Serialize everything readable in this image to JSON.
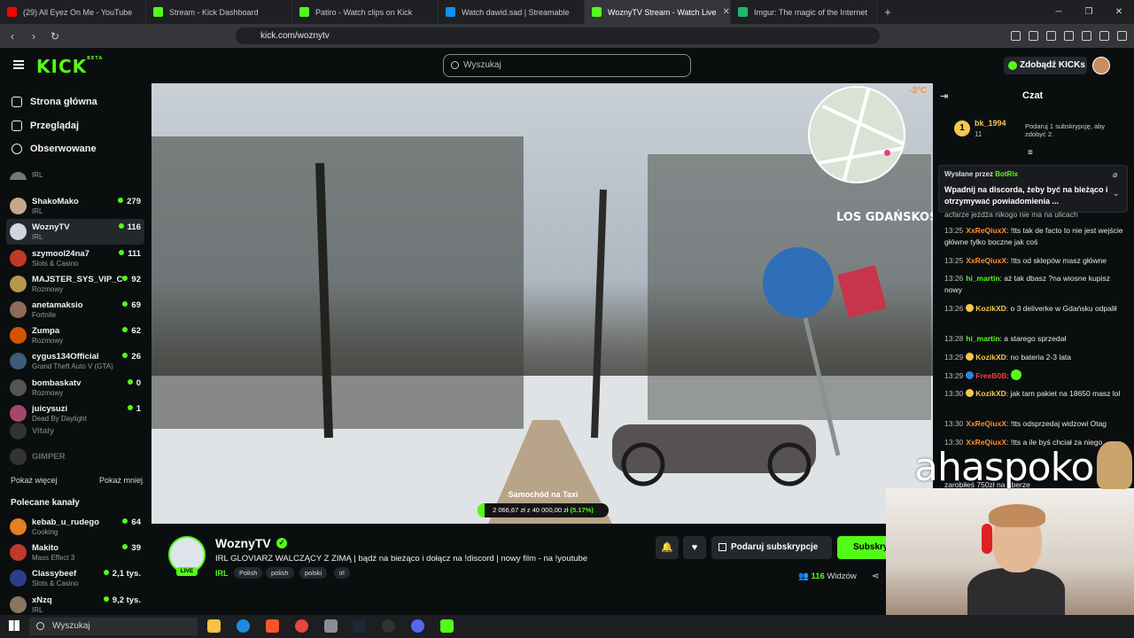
{
  "browser": {
    "tabs": [
      {
        "title": "(29) All Eyez On Me - YouTube",
        "color": "#ff0000"
      },
      {
        "title": "Stream - Kick Dashboard",
        "color": "#53fc18"
      },
      {
        "title": "Patiro - Watch clips on Kick",
        "color": "#53fc18"
      },
      {
        "title": "Watch dawid.sad | Streamable",
        "color": "#0f90fa"
      },
      {
        "title": "WoznyTV Stream - Watch Live",
        "color": "#53fc18"
      },
      {
        "title": "Imgur: The magic of the Internet",
        "color": "#1bb76e"
      }
    ],
    "url": "kick.com/woznytv"
  },
  "header": {
    "logo": "KICK",
    "logo_sup": "BETA",
    "search_placeholder": "Wyszukaj",
    "get_kicks": "Zdobądź KICKs"
  },
  "sidebar": {
    "nav": [
      "Strona główna",
      "Przeglądaj",
      "Obserwowane"
    ],
    "followed": [
      {
        "name": "",
        "category": "IRL",
        "viewers": "",
        "color": "#777"
      },
      {
        "name": "ShakoMako",
        "category": "IRL",
        "viewers": "279",
        "color": "#c6a78a"
      },
      {
        "name": "WoznyTV",
        "category": "IRL",
        "viewers": "116",
        "color": "#cfd6de"
      },
      {
        "name": "szymool24na7",
        "category": "Slots & Casino",
        "viewers": "111",
        "color": "#c0392b"
      },
      {
        "name": "MAJSTER_SYS_VIP_C",
        "category": "Rozmowy",
        "viewers": "92",
        "color": "#b7964d"
      },
      {
        "name": "anetamaksio",
        "category": "Fortnite",
        "viewers": "69",
        "color": "#8e6b5a"
      },
      {
        "name": "Zumpa",
        "category": "Rozmowy",
        "viewers": "62",
        "color": "#d35400"
      },
      {
        "name": "cygus134Official",
        "category": "Grand Theft Auto V (GTA)",
        "viewers": "26",
        "color": "#3b5d7a"
      },
      {
        "name": "bombaskatv",
        "category": "Rozmowy",
        "viewers": "0",
        "color": "#555"
      },
      {
        "name": "juicysuzi",
        "category": "Dead By Daylight",
        "viewers": "1",
        "color": "#a3476b"
      }
    ],
    "offline": [
      "Vitaly",
      "GIMPER"
    ],
    "show_more": "Pokaż więcej",
    "show_less": "Pokaż mniej",
    "recommended_title": "Polecane kanały",
    "recommended": [
      {
        "name": "kebab_u_rudego",
        "category": "Cooking",
        "viewers": "64",
        "color": "#e67e22"
      },
      {
        "name": "Makito",
        "category": "Mass Effect 3",
        "viewers": "39",
        "color": "#c0392b"
      },
      {
        "name": "Classybeef",
        "category": "Slots & Casino",
        "viewers": "2,1 tys.",
        "color": "#2c3e8a"
      },
      {
        "name": "xNzq",
        "category": "IRL",
        "viewers": "9,2 tys.",
        "color": "#8a7560"
      }
    ]
  },
  "video": {
    "temperature": "-3°C",
    "map_label": "LOS GDAŃSKOS",
    "goal_title": "Samochód na Taxi",
    "goal_current": "2 066,67 zł",
    "goal_separator": "z",
    "goal_target": "40 000,00 zł",
    "goal_percent": "(5.17%)",
    "goal_fraction": 0.0517
  },
  "stream": {
    "name": "WoznyTV",
    "live": "LIVE",
    "title": "IRL GLOVIARZ WALCZĄCY Z ZIMĄ | bądź na bieżąco i dołącz na !discord | nowy film - na !youtube",
    "category": "IRL",
    "tags": [
      "Polish",
      "polish",
      "polski",
      "irl"
    ],
    "gift_sub": "Podaruj subskrypcje",
    "subscribe": "Subskrybuj",
    "viewers_count": "116",
    "viewers_label": "Widzów"
  },
  "chat": {
    "title": "Czat",
    "leader_user": "bk_1994",
    "leader_count": "11",
    "leader_note": "Podaruj 1 subskrypcję, aby zdobyć 2.",
    "pinned_by_label": "Wysłane przez",
    "pinned_by_user": "BotRix",
    "pinned_text": "Wpadnij na discorda, żeby być na bieżąco i otrzymywać powiadomienia ...",
    "partial": "acfarze jeżdża nikogo nie ma na ulicach",
    "messages": [
      {
        "time": "13:25",
        "user": "XxReQiuxX",
        "color": "#ff8e2c",
        "text": "!tts tak de facto to nie jest wejście główne tylko boczne jak coś"
      },
      {
        "time": "13:25",
        "user": "XxReQiuxX",
        "color": "#ff8e2c",
        "text": "!tts od sklepów masz główne"
      },
      {
        "time": "13:26",
        "user": "hi_martin",
        "color": "#53fc18",
        "text": "aż tak dbasz ?na wiosne kupisz nowy"
      },
      {
        "time": "13:26",
        "user": "KozikXD",
        "color": "#f2c94c",
        "text": "o 3 deliverke w Gdańsku odpalił"
      },
      {
        "time": "13:28",
        "user": "hi_martin",
        "color": "#53fc18",
        "text": "a starego sprzedał"
      },
      {
        "time": "13:29",
        "user": "KozikXD",
        "color": "#f2c94c",
        "text": "no bateria 2-3 lata"
      },
      {
        "time": "13:29",
        "user": "FreeB0B",
        "color": "#ff3b3b",
        "text": ""
      },
      {
        "time": "13:30",
        "user": "KozikXD",
        "color": "#f2c94c",
        "text": "jak tam pakiet na 18650 masz lol"
      },
      {
        "time": "13:30",
        "user": "XxReQiuxX",
        "color": "#ff8e2c",
        "text": "!tts odsprzedaj widzowi Otag"
      },
      {
        "time": "13:30",
        "user": "XxReQiuxX",
        "color": "#ff8e2c",
        "text": "!tts a ile byś chciał za niego"
      },
      {
        "time": "",
        "user": "",
        "color": "#53fc18",
        "text": "zarobiłeś 750zł na uberze"
      }
    ]
  },
  "overlay": {
    "watermark": "ahaspoko"
  },
  "taskbar": {
    "search": "Wyszukaj"
  }
}
